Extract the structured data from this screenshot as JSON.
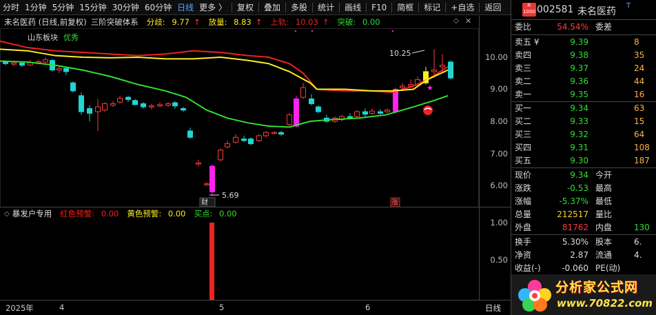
{
  "toolbar": {
    "period_tabs": [
      "分时",
      "1分钟",
      "5分钟",
      "15分钟",
      "30分钟",
      "60分钟",
      "日线",
      "更多"
    ],
    "more_chevron": "〉",
    "tools": [
      "复权",
      "叠加",
      "多股",
      "统计",
      "画线",
      "F10",
      "简框",
      "标记",
      "+自选",
      "返回"
    ]
  },
  "main_chart": {
    "title": "未名医药 (日线,前复权)",
    "indicator": "三阶突破体系",
    "fenqi_label": "分歧:",
    "fenqi_value": "9.77",
    "fangliang_label": "放量:",
    "fangliang_value": "8.83",
    "shanggui_label": "上轨:",
    "shanggui_value": "10.03",
    "tupo_label": "突破:",
    "tupo_value": "0.00",
    "sector_tag": "山东板块",
    "sector_status": "优秀",
    "high_annotation": "10.25",
    "low_annotation": "5.69",
    "event_finance": "财",
    "event_up": "涨",
    "y_ticks": [
      "10.00",
      "9.00",
      "8.00",
      "7.00",
      "6.00"
    ]
  },
  "sub_chart": {
    "title": "暴发户专用",
    "red_warn_label": "红色预警:",
    "red_warn_value": "0.00",
    "yellow_warn_label": "黄色预警:",
    "yellow_warn_value": "0.00",
    "buy_label": "买点:",
    "buy_value": "0.00",
    "y_ticks": [
      "1.00",
      "0.50"
    ]
  },
  "x_axis": {
    "labels": [
      "2025年",
      "4",
      "5",
      "6"
    ],
    "period_label": "日线"
  },
  "quote": {
    "code": "002581",
    "name": "未名医药",
    "badge_top": "R",
    "badge_bottom": "1000",
    "superscript": "T",
    "weibi_label": "委比",
    "weibi_value": "54.54%",
    "weicha_label": "委差",
    "asks": [
      {
        "label": "卖五 ¥",
        "price": "9.39",
        "vol": "8"
      },
      {
        "label": "卖四",
        "price": "9.38",
        "vol": "35"
      },
      {
        "label": "卖三",
        "price": "9.37",
        "vol": "24"
      },
      {
        "label": "卖二",
        "price": "9.36",
        "vol": "44"
      },
      {
        "label": "卖一",
        "price": "9.35",
        "vol": "16"
      }
    ],
    "bids": [
      {
        "label": "买一",
        "price": "9.34",
        "vol": "63"
      },
      {
        "label": "买二",
        "price": "9.33",
        "vol": "15"
      },
      {
        "label": "买三",
        "price": "9.32",
        "vol": "64"
      },
      {
        "label": "买四",
        "price": "9.31",
        "vol": "108"
      },
      {
        "label": "买五",
        "price": "9.30",
        "vol": "187"
      }
    ],
    "stats": [
      {
        "l": "现价",
        "v": "9.34",
        "l2": "今开"
      },
      {
        "l": "涨跌",
        "v": "-0.53",
        "l2": "最高"
      },
      {
        "l": "涨幅",
        "v": "-5.37%",
        "l2": "最低"
      },
      {
        "l": "总量",
        "v": "212517",
        "l2": "量比"
      },
      {
        "l": "外盘",
        "v": "81762",
        "l2": "内盘",
        "v2": "130"
      }
    ],
    "stats2": [
      {
        "l": "换手",
        "v": "5.30%",
        "l2": "股本",
        "v2": "6."
      },
      {
        "l": "净资",
        "v": "2.87",
        "l2": "流通",
        "v2": "4."
      },
      {
        "l": "收益(-)",
        "v": "-0.060",
        "l2": "PE(动)"
      }
    ]
  },
  "logo": {
    "text": "分析家公式网",
    "url": "www.70822.com"
  },
  "colors": {
    "up": "#ff3b3b",
    "down": "#22d3d3",
    "green": "#33dd33",
    "yellow": "#ffee22",
    "red": "#ee2222",
    "magenta": "#ff22ee"
  }
}
